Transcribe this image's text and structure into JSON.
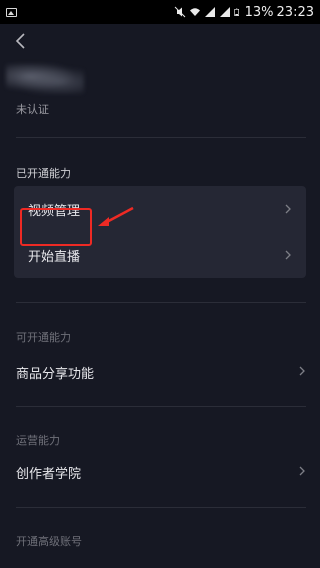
{
  "status_bar": {
    "battery_percent": "13%",
    "time": "23:23",
    "icons": [
      "gallery-icon",
      "mute-icon",
      "wifi-icon",
      "signal-icon",
      "signal-icon",
      "battery-icon"
    ]
  },
  "header": {
    "back_icon": "chevron-left-icon"
  },
  "profile": {
    "verification_status": "未认证"
  },
  "enabled_section": {
    "title": "已开通能力",
    "items": [
      {
        "label": "视频管理"
      },
      {
        "label": "开始直播"
      }
    ]
  },
  "available_section": {
    "title": "可开通能力",
    "items": [
      {
        "label": "商品分享功能"
      }
    ]
  },
  "operations_section": {
    "title": "运营能力",
    "items": [
      {
        "label": "创作者学院"
      }
    ]
  },
  "advanced_section": {
    "title": "开通高级账号"
  },
  "colors": {
    "background": "#161823",
    "card": "#252734",
    "annotation": "#ee2a24"
  }
}
